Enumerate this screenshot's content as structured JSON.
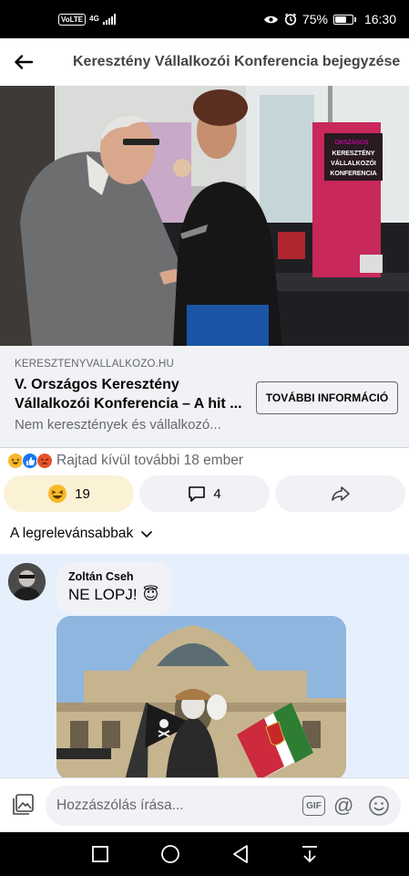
{
  "status_bar": {
    "volte": "VoLTE",
    "network": "4G",
    "battery": "75%",
    "battery_level": 0.75,
    "time": "16:30",
    "icons": [
      "eye-icon",
      "alarm-icon",
      "battery-icon",
      "signal-icon"
    ]
  },
  "header": {
    "title": "Keresztény Vállalkozói Konferencia bejegyzése",
    "back_icon": "arrow-left-icon"
  },
  "hero": {
    "sign_text": [
      "ORSZÁGOS",
      "KERESZTÉNY",
      "VÁLLALKOZÓI",
      "KONFERENCIA"
    ]
  },
  "link_preview": {
    "domain": "KERESZTENYVALLALKOZO.HU",
    "title": "V. Országos Keresztény Vállalkozói Konferencia – A hit ...",
    "description": "Nem keresztények és vállalkozó...",
    "button_label": "TOVÁBBI INFORMÁCIÓ"
  },
  "reactions": {
    "summary": "Rajtad kívül további 18 ember",
    "icons": [
      "haha-icon",
      "like-icon",
      "angry-icon"
    ],
    "reaction_count": "19",
    "comment_count": "4"
  },
  "sort": {
    "label": "A legrelevánsabbak"
  },
  "comment": {
    "author": "Zoltán Cseh",
    "text": "NE LOPJ!",
    "emoji": "😇"
  },
  "composer": {
    "placeholder": "Hozzászólás írása...",
    "gif_label": "GIF",
    "at_label": "@"
  },
  "colors": {
    "accent_reaction_bg": "#fbf1d5",
    "surface": "#f0f2f5",
    "comment_bg": "#e6f0fd",
    "secondary_text": "#65676b"
  }
}
